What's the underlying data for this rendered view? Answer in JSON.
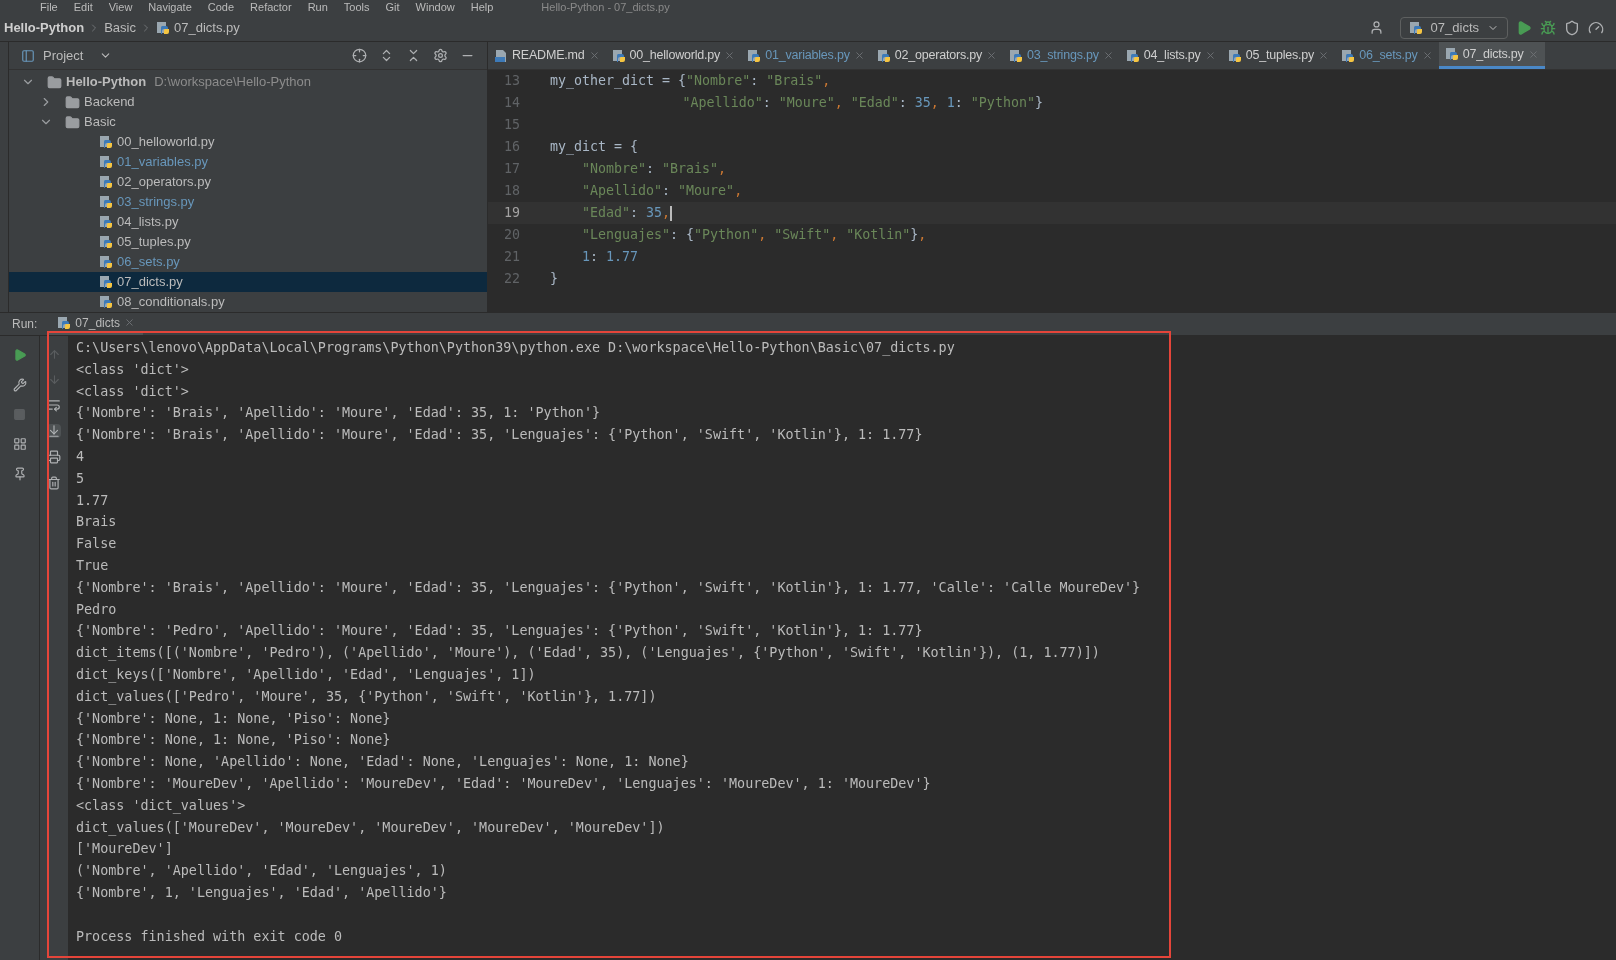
{
  "menu_bar": {
    "items": [
      "File",
      "Edit",
      "View",
      "Navigate",
      "Code",
      "Refactor",
      "Run",
      "Tools",
      "Git",
      "Window",
      "Help"
    ],
    "title": "Hello-Python - 07_dicts.py"
  },
  "breadcrumbs": [
    "Hello-Python",
    "Basic",
    "07_dicts.py"
  ],
  "run_config": "07_dicts",
  "project_panel": {
    "title": "Project",
    "tree": [
      {
        "label": "Hello-Python",
        "path": "D:\\workspace\\Hello-Python",
        "kind": "folder",
        "expanded": true,
        "selected": false,
        "children": [
          {
            "label": "Backend",
            "kind": "folder",
            "expanded": false,
            "selected": false
          },
          {
            "label": "Basic",
            "kind": "folder",
            "expanded": true,
            "selected": false,
            "children": [
              {
                "label": "00_helloworld.py",
                "kind": "file",
                "modified": false,
                "selected": false
              },
              {
                "label": "01_variables.py",
                "kind": "file",
                "modified": true,
                "selected": false
              },
              {
                "label": "02_operators.py",
                "kind": "file",
                "modified": false,
                "selected": false
              },
              {
                "label": "03_strings.py",
                "kind": "file",
                "modified": true,
                "selected": false
              },
              {
                "label": "04_lists.py",
                "kind": "file",
                "modified": false,
                "selected": false
              },
              {
                "label": "05_tuples.py",
                "kind": "file",
                "modified": false,
                "selected": false
              },
              {
                "label": "06_sets.py",
                "kind": "file",
                "modified": true,
                "selected": false
              },
              {
                "label": "07_dicts.py",
                "kind": "file",
                "modified": false,
                "selected": true
              },
              {
                "label": "08_conditionals.py",
                "kind": "file",
                "modified": false,
                "selected": false
              }
            ]
          }
        ]
      }
    ]
  },
  "editor_tabs": [
    {
      "label": "README.md",
      "kind": "markdown",
      "modified": false,
      "selected": false
    },
    {
      "label": "00_helloworld.py",
      "kind": "python",
      "modified": false,
      "selected": false
    },
    {
      "label": "01_variables.py",
      "kind": "python",
      "modified": true,
      "selected": false
    },
    {
      "label": "02_operators.py",
      "kind": "python",
      "modified": false,
      "selected": false
    },
    {
      "label": "03_strings.py",
      "kind": "python",
      "modified": true,
      "selected": false
    },
    {
      "label": "04_lists.py",
      "kind": "python",
      "modified": false,
      "selected": false
    },
    {
      "label": "05_tuples.py",
      "kind": "python",
      "modified": false,
      "selected": false
    },
    {
      "label": "06_sets.py",
      "kind": "python",
      "modified": true,
      "selected": false
    },
    {
      "label": "07_dicts.py",
      "kind": "python",
      "modified": false,
      "selected": true
    }
  ],
  "editor": {
    "lines": [
      {
        "number": "13",
        "current": false,
        "tokens": [
          {
            "kind": "text",
            "text": "my_other_dict = {"
          },
          {
            "kind": "string",
            "text": "\"Nombre\""
          },
          {
            "kind": "text",
            "text": ": "
          },
          {
            "kind": "string",
            "text": "\"Brais\""
          },
          {
            "kind": "punct",
            "text": ","
          }
        ]
      },
      {
        "number": "14",
        "current": false,
        "kind": "continuation",
        "tokens": [
          {
            "kind": "string",
            "text": "\"Apellido\""
          },
          {
            "kind": "text",
            "text": ": "
          },
          {
            "kind": "string",
            "text": "\"Moure\""
          },
          {
            "kind": "punct",
            "text": ", "
          },
          {
            "kind": "string",
            "text": "\"Edad\""
          },
          {
            "kind": "text",
            "text": ": "
          },
          {
            "kind": "number",
            "text": "35"
          },
          {
            "kind": "punct",
            "text": ", "
          },
          {
            "kind": "number",
            "text": "1"
          },
          {
            "kind": "text",
            "text": ": "
          },
          {
            "kind": "string",
            "text": "\"Python\""
          },
          {
            "kind": "text",
            "text": "}"
          }
        ]
      },
      {
        "number": "15",
        "current": false
      },
      {
        "number": "16",
        "current": false,
        "tokens": [
          {
            "kind": "text",
            "text": "my_dict = {"
          }
        ]
      },
      {
        "number": "17",
        "current": false,
        "kind": "block",
        "tokens": [
          {
            "kind": "string",
            "text": "\"Nombre\""
          },
          {
            "kind": "text",
            "text": ": "
          },
          {
            "kind": "string",
            "text": "\"Brais\""
          },
          {
            "kind": "punct",
            "text": ","
          }
        ]
      },
      {
        "number": "18",
        "current": false,
        "kind": "block",
        "tokens": [
          {
            "kind": "string",
            "text": "\"Apellido\""
          },
          {
            "kind": "text",
            "text": ": "
          },
          {
            "kind": "string",
            "text": "\"Moure\""
          },
          {
            "kind": "punct",
            "text": ","
          }
        ]
      },
      {
        "number": "19",
        "current": true,
        "kind": "block",
        "tokens": [
          {
            "kind": "string",
            "text": "\"Edad\""
          },
          {
            "kind": "text",
            "text": ": "
          },
          {
            "kind": "number",
            "text": "35"
          },
          {
            "kind": "punct",
            "text": ","
          }
        ]
      },
      {
        "number": "20",
        "current": false,
        "kind": "block",
        "tokens": [
          {
            "kind": "string",
            "text": "\"Lenguajes\""
          },
          {
            "kind": "text",
            "text": ": {"
          },
          {
            "kind": "string",
            "text": "\"Python\""
          },
          {
            "kind": "punct",
            "text": ", "
          },
          {
            "kind": "string",
            "text": "\"Swift\""
          },
          {
            "kind": "punct",
            "text": ", "
          },
          {
            "kind": "string",
            "text": "\"Kotlin\""
          },
          {
            "kind": "text",
            "text": "}"
          },
          {
            "kind": "punct",
            "text": ","
          }
        ]
      },
      {
        "number": "21",
        "current": false,
        "kind": "block",
        "tokens": [
          {
            "kind": "number",
            "text": "1"
          },
          {
            "kind": "text",
            "text": ": "
          },
          {
            "kind": "number",
            "text": "1.77"
          }
        ]
      },
      {
        "number": "22",
        "current": false,
        "tokens": [
          {
            "kind": "text",
            "text": "}"
          }
        ]
      }
    ]
  },
  "run_panel": {
    "label": "Run:",
    "tab": "07_dicts",
    "output": [
      "C:\\Users\\lenovo\\AppData\\Local\\Programs\\Python\\Python39\\python.exe D:\\workspace\\Hello-Python\\Basic\\07_dicts.py",
      "<class 'dict'>",
      "<class 'dict'>",
      "{'Nombre': 'Brais', 'Apellido': 'Moure', 'Edad': 35, 1: 'Python'}",
      "{'Nombre': 'Brais', 'Apellido': 'Moure', 'Edad': 35, 'Lenguajes': {'Python', 'Swift', 'Kotlin'}, 1: 1.77}",
      "4",
      "5",
      "1.77",
      "Brais",
      "False",
      "True",
      "{'Nombre': 'Brais', 'Apellido': 'Moure', 'Edad': 35, 'Lenguajes': {'Python', 'Swift', 'Kotlin'}, 1: 1.77, 'Calle': 'Calle MoureDev'}",
      "Pedro",
      "{'Nombre': 'Pedro', 'Apellido': 'Moure', 'Edad': 35, 'Lenguajes': {'Python', 'Swift', 'Kotlin'}, 1: 1.77}",
      "dict_items([('Nombre', 'Pedro'), ('Apellido', 'Moure'), ('Edad', 35), ('Lenguajes', {'Python', 'Swift', 'Kotlin'}), (1, 1.77)])",
      "dict_keys(['Nombre', 'Apellido', 'Edad', 'Lenguajes', 1])",
      "dict_values(['Pedro', 'Moure', 35, {'Python', 'Swift', 'Kotlin'}, 1.77])",
      "{'Nombre': None, 1: None, 'Piso': None}",
      "{'Nombre': None, 1: None, 'Piso': None}",
      "{'Nombre': None, 'Apellido': None, 'Edad': None, 'Lenguajes': None, 1: None}",
      "{'Nombre': 'MoureDev', 'Apellido': 'MoureDev', 'Edad': 'MoureDev', 'Lenguajes': 'MoureDev', 1: 'MoureDev'}",
      "<class 'dict_values'>",
      "dict_values(['MoureDev', 'MoureDev', 'MoureDev', 'MoureDev', 'MoureDev'])",
      "['MoureDev']",
      "('Nombre', 'Apellido', 'Edad', 'Lenguajes', 1)",
      "{'Nombre', 1, 'Lenguajes', 'Edad', 'Apellido'}"
    ],
    "exit_message": "Process finished with exit code 0"
  }
}
